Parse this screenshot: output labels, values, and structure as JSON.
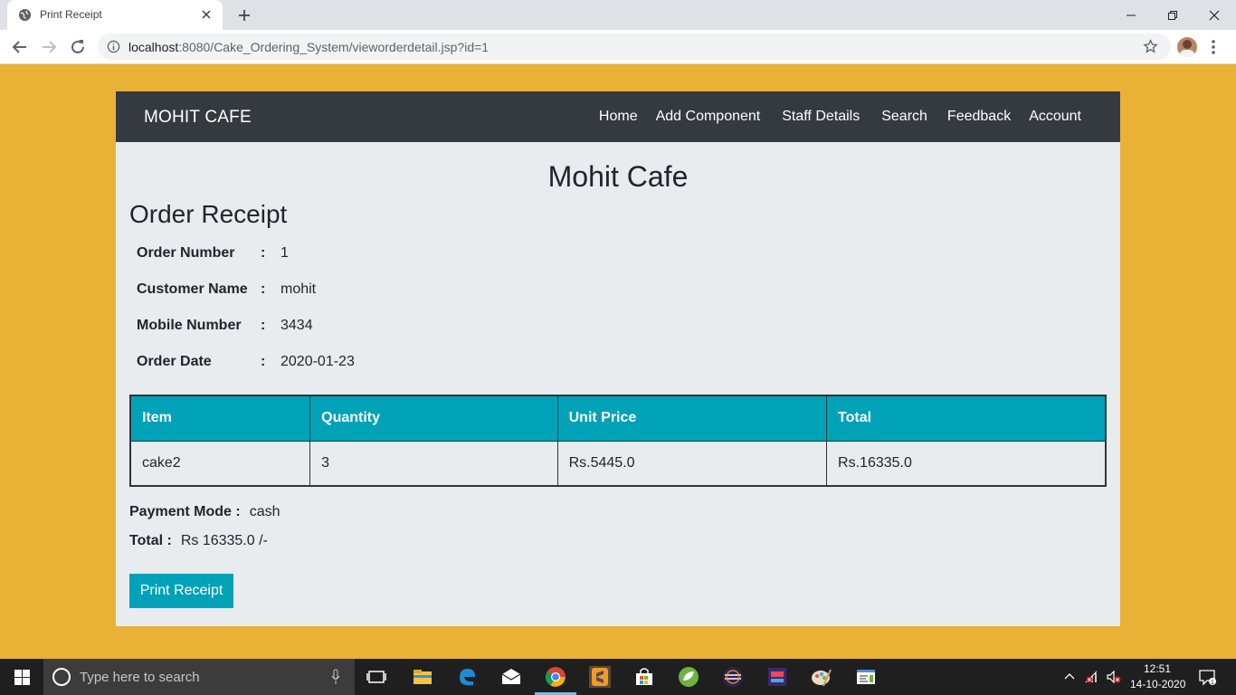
{
  "browser": {
    "tab_title": "Print Receipt",
    "url_host": "localhost",
    "url_rest": ":8080/Cake_Ordering_System/vieworderdetail.jsp?id=1"
  },
  "nav": {
    "brand": "MOHIT CAFE",
    "links": [
      "Home",
      "Add Component",
      "Staff Details",
      "Search",
      "Feedback",
      "Account"
    ]
  },
  "page": {
    "cafe_title": "Mohit Cafe",
    "receipt_title": "Order Receipt"
  },
  "order": {
    "fields": [
      {
        "label": "Order Number",
        "value": "1"
      },
      {
        "label": "Customer Name",
        "value": "mohit"
      },
      {
        "label": "Mobile Number",
        "value": "3434"
      },
      {
        "label": "Order Date",
        "value": "2020-01-23"
      }
    ],
    "colon": ":"
  },
  "table": {
    "headers": [
      "Item",
      "Quantity",
      "Unit Price",
      "Total"
    ],
    "rows": [
      [
        "cake2",
        "3",
        "Rs.5445.0",
        "Rs.16335.0"
      ]
    ]
  },
  "payment": {
    "mode_label": "Payment Mode :",
    "mode_value": "cash",
    "total_label": "Total :",
    "total_value": "Rs 16335.0 /-"
  },
  "actions": {
    "print_label": "Print Receipt"
  },
  "taskbar": {
    "search_placeholder": "Type here to search",
    "time": "12:51",
    "date": "14-10-2020"
  },
  "colors": {
    "page_bg": "#e9b236",
    "navbar_bg": "#343a40",
    "accent": "#00a2b8",
    "card_bg": "#e9ecef"
  }
}
